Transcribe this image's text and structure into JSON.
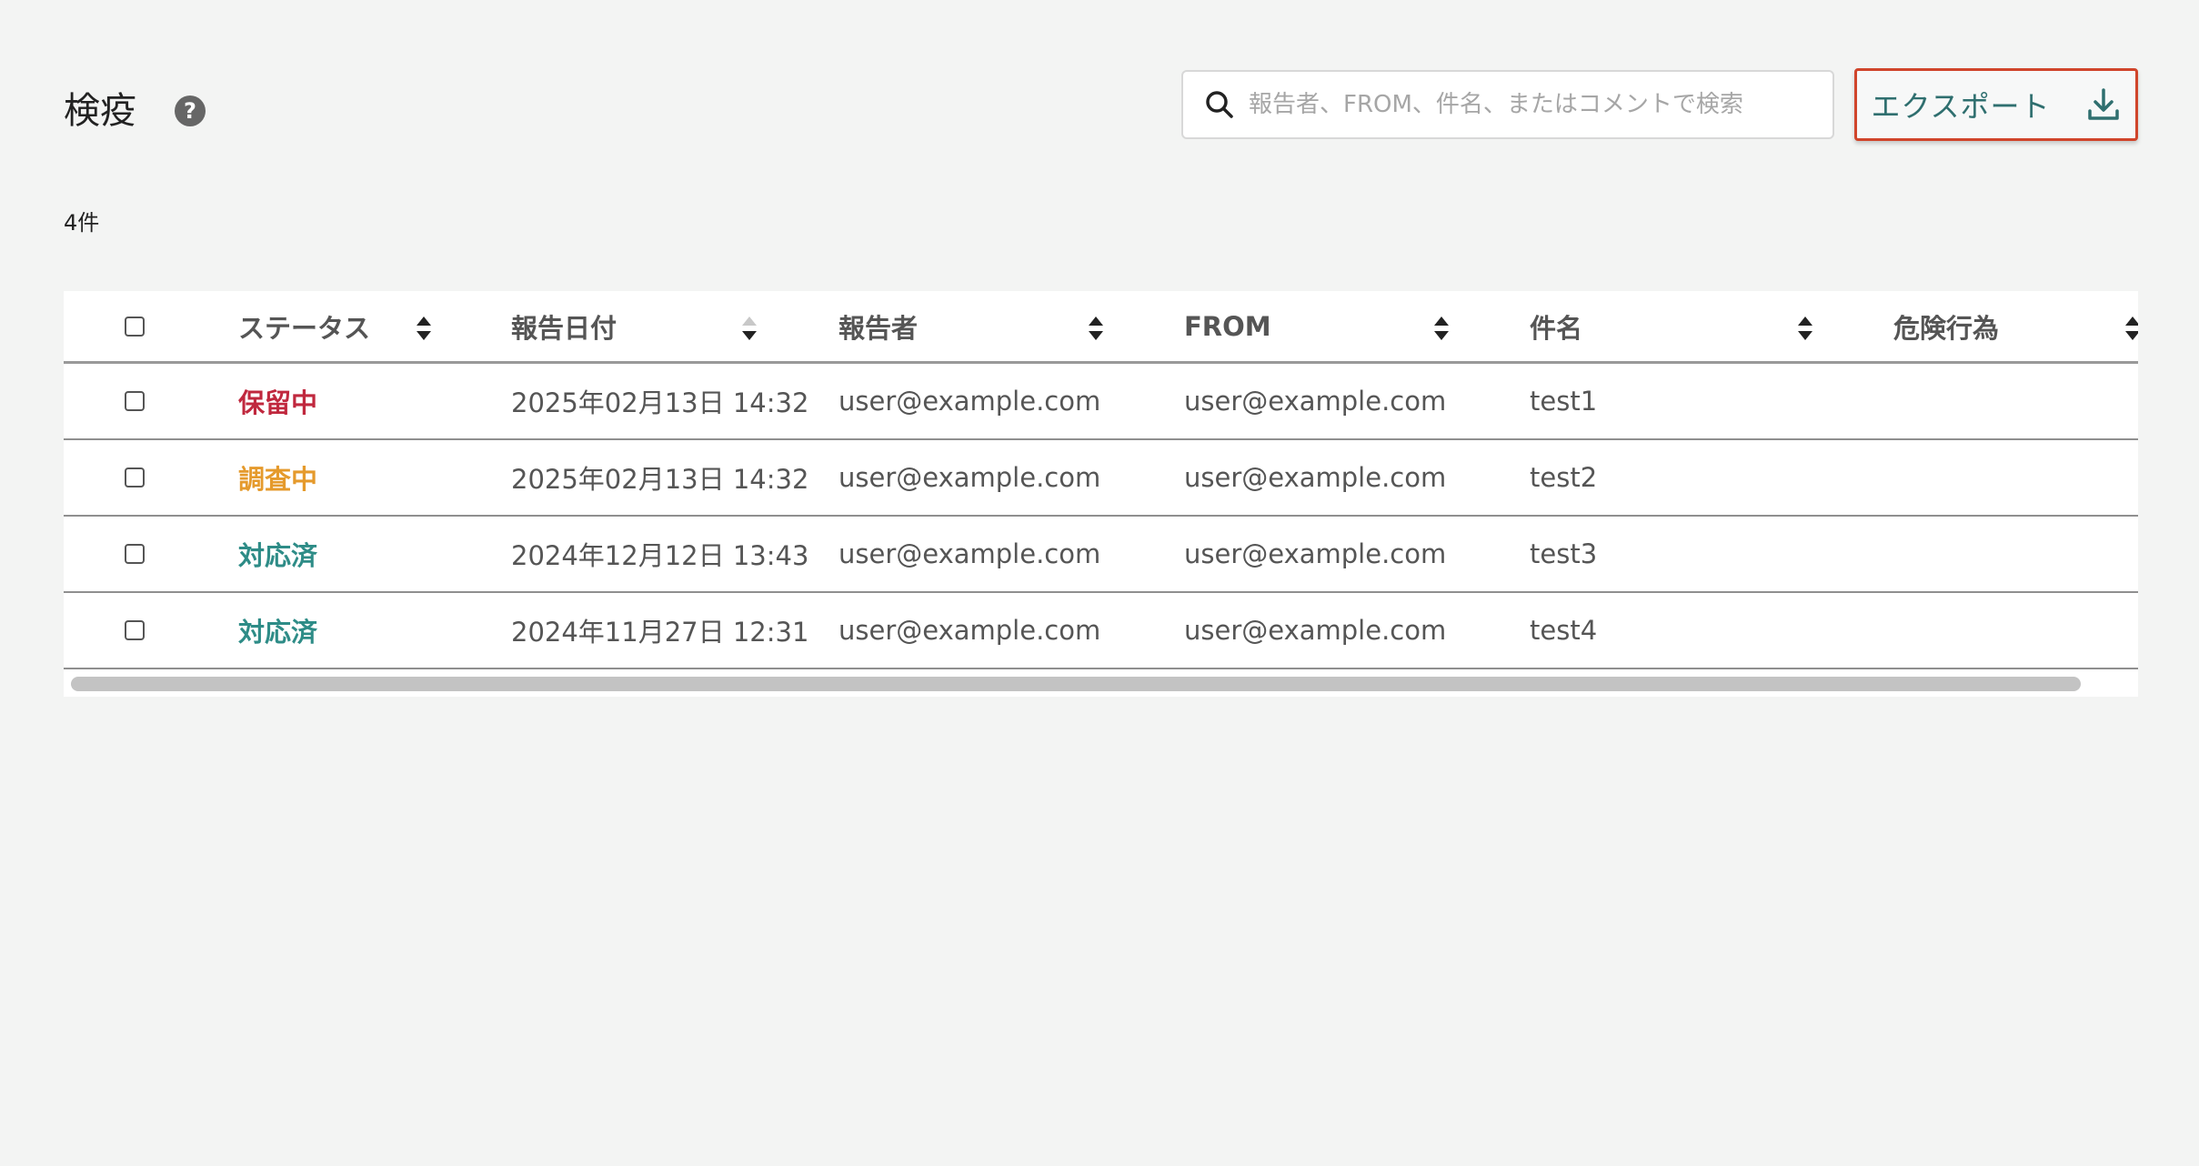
{
  "page": {
    "title": "検疫",
    "help_glyph": "?",
    "count_text": "4件"
  },
  "search": {
    "placeholder": "報告者、FROM、件名、またはコメントで検索",
    "value": ""
  },
  "export": {
    "label": "エクスポート"
  },
  "colors": {
    "accent": "#2f6f6f",
    "status_hold": "#c0283e",
    "status_investigating": "#e59a2c",
    "status_done": "#2e8c87",
    "highlight_border": "#d0452b"
  },
  "icons": {
    "help": "help-icon",
    "search": "search-icon",
    "export": "download-icon",
    "sort": "sort-icon"
  },
  "table": {
    "columns": [
      "ステータス",
      "報告日付",
      "報告者",
      "FROM",
      "件名",
      "危険行為"
    ],
    "rows": [
      {
        "status": "保留中",
        "date": "2025年02月13日 14:32",
        "reporter": "user@example.com",
        "from": "user@example.com",
        "subject": "test1",
        "risk": ""
      },
      {
        "status": "調査中",
        "date": "2025年02月13日 14:32",
        "reporter": "user@example.com",
        "from": "user@example.com",
        "subject": "test2",
        "risk": ""
      },
      {
        "status": "対応済",
        "date": "2024年12月12日 13:43",
        "reporter": "user@example.com",
        "from": "user@example.com",
        "subject": "test3",
        "risk": ""
      },
      {
        "status": "対応済",
        "date": "2024年11月27日 12:31",
        "reporter": "user@example.com",
        "from": "user@example.com",
        "subject": "test4",
        "risk": ""
      }
    ]
  }
}
